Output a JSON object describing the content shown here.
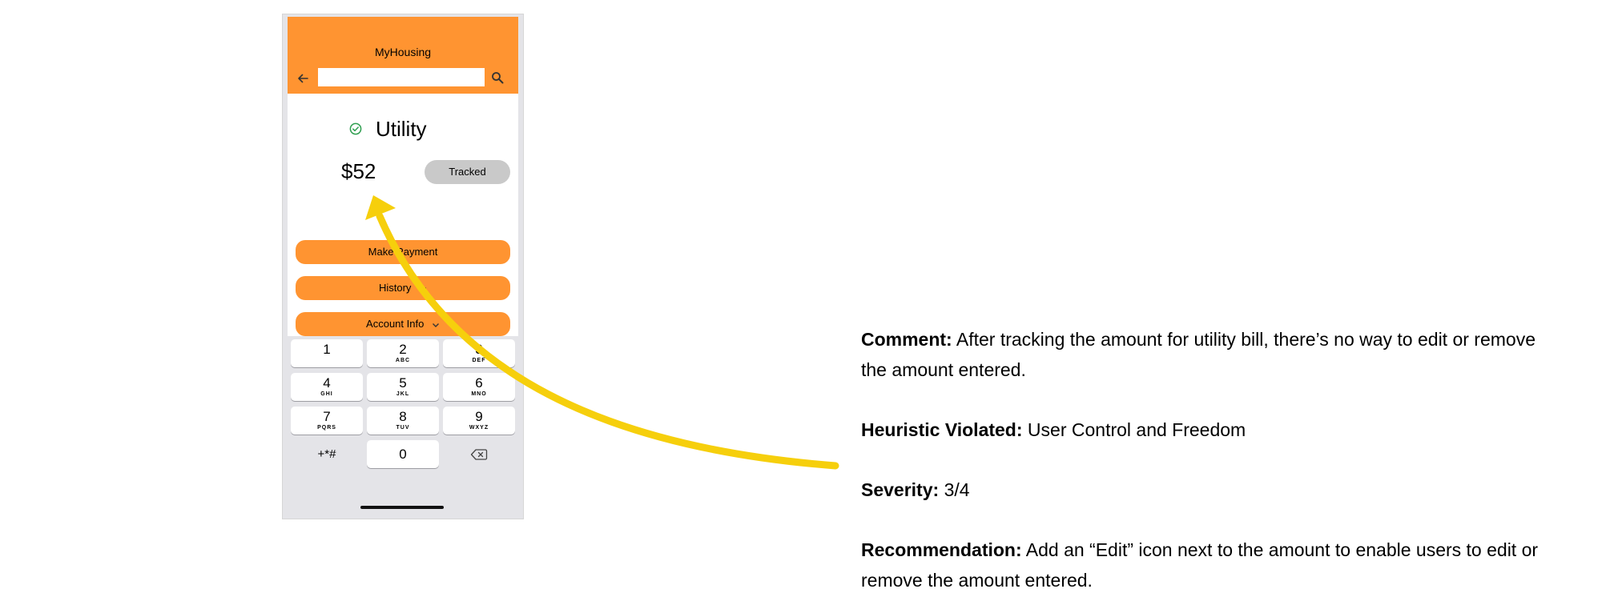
{
  "app": {
    "title": "MyHousing",
    "search_placeholder": ""
  },
  "bill": {
    "title": "Utility",
    "amount": "$52",
    "status_button": "Tracked"
  },
  "actions": {
    "make_payment": "Make Payment",
    "history": "History",
    "account_info": "Account Info"
  },
  "keypad": {
    "keys": [
      {
        "num": "1",
        "letters": ""
      },
      {
        "num": "2",
        "letters": "ABC"
      },
      {
        "num": "3",
        "letters": "DEF"
      },
      {
        "num": "4",
        "letters": "GHI"
      },
      {
        "num": "5",
        "letters": "JKL"
      },
      {
        "num": "6",
        "letters": "MNO"
      },
      {
        "num": "7",
        "letters": "PQRS"
      },
      {
        "num": "8",
        "letters": "TUV"
      },
      {
        "num": "9",
        "letters": "WXYZ"
      }
    ],
    "symbols": "+*#",
    "zero": "0"
  },
  "annotation": {
    "comment_label": "Comment:",
    "comment_text": "After tracking the amount for utility bill, there’s no way to edit or remove the amount entered.",
    "heuristic_label": "Heuristic Violated:",
    "heuristic_text": "User Control and Freedom",
    "severity_label": "Severity:",
    "severity_text": "3/4",
    "recommendation_label": "Recommendation:",
    "recommendation_text": "Add an “Edit” icon next to the amount to enable users to edit or remove the amount entered."
  },
  "colors": {
    "brand_orange": "#ff9431",
    "arrow_yellow": "#f6cf0c",
    "check_green": "#2e9e4f",
    "tracked_gray": "#c9c9c9"
  },
  "icons": [
    "back-arrow-icon",
    "search-icon",
    "check-circle-icon",
    "chevron-down-icon",
    "backspace-icon"
  ]
}
